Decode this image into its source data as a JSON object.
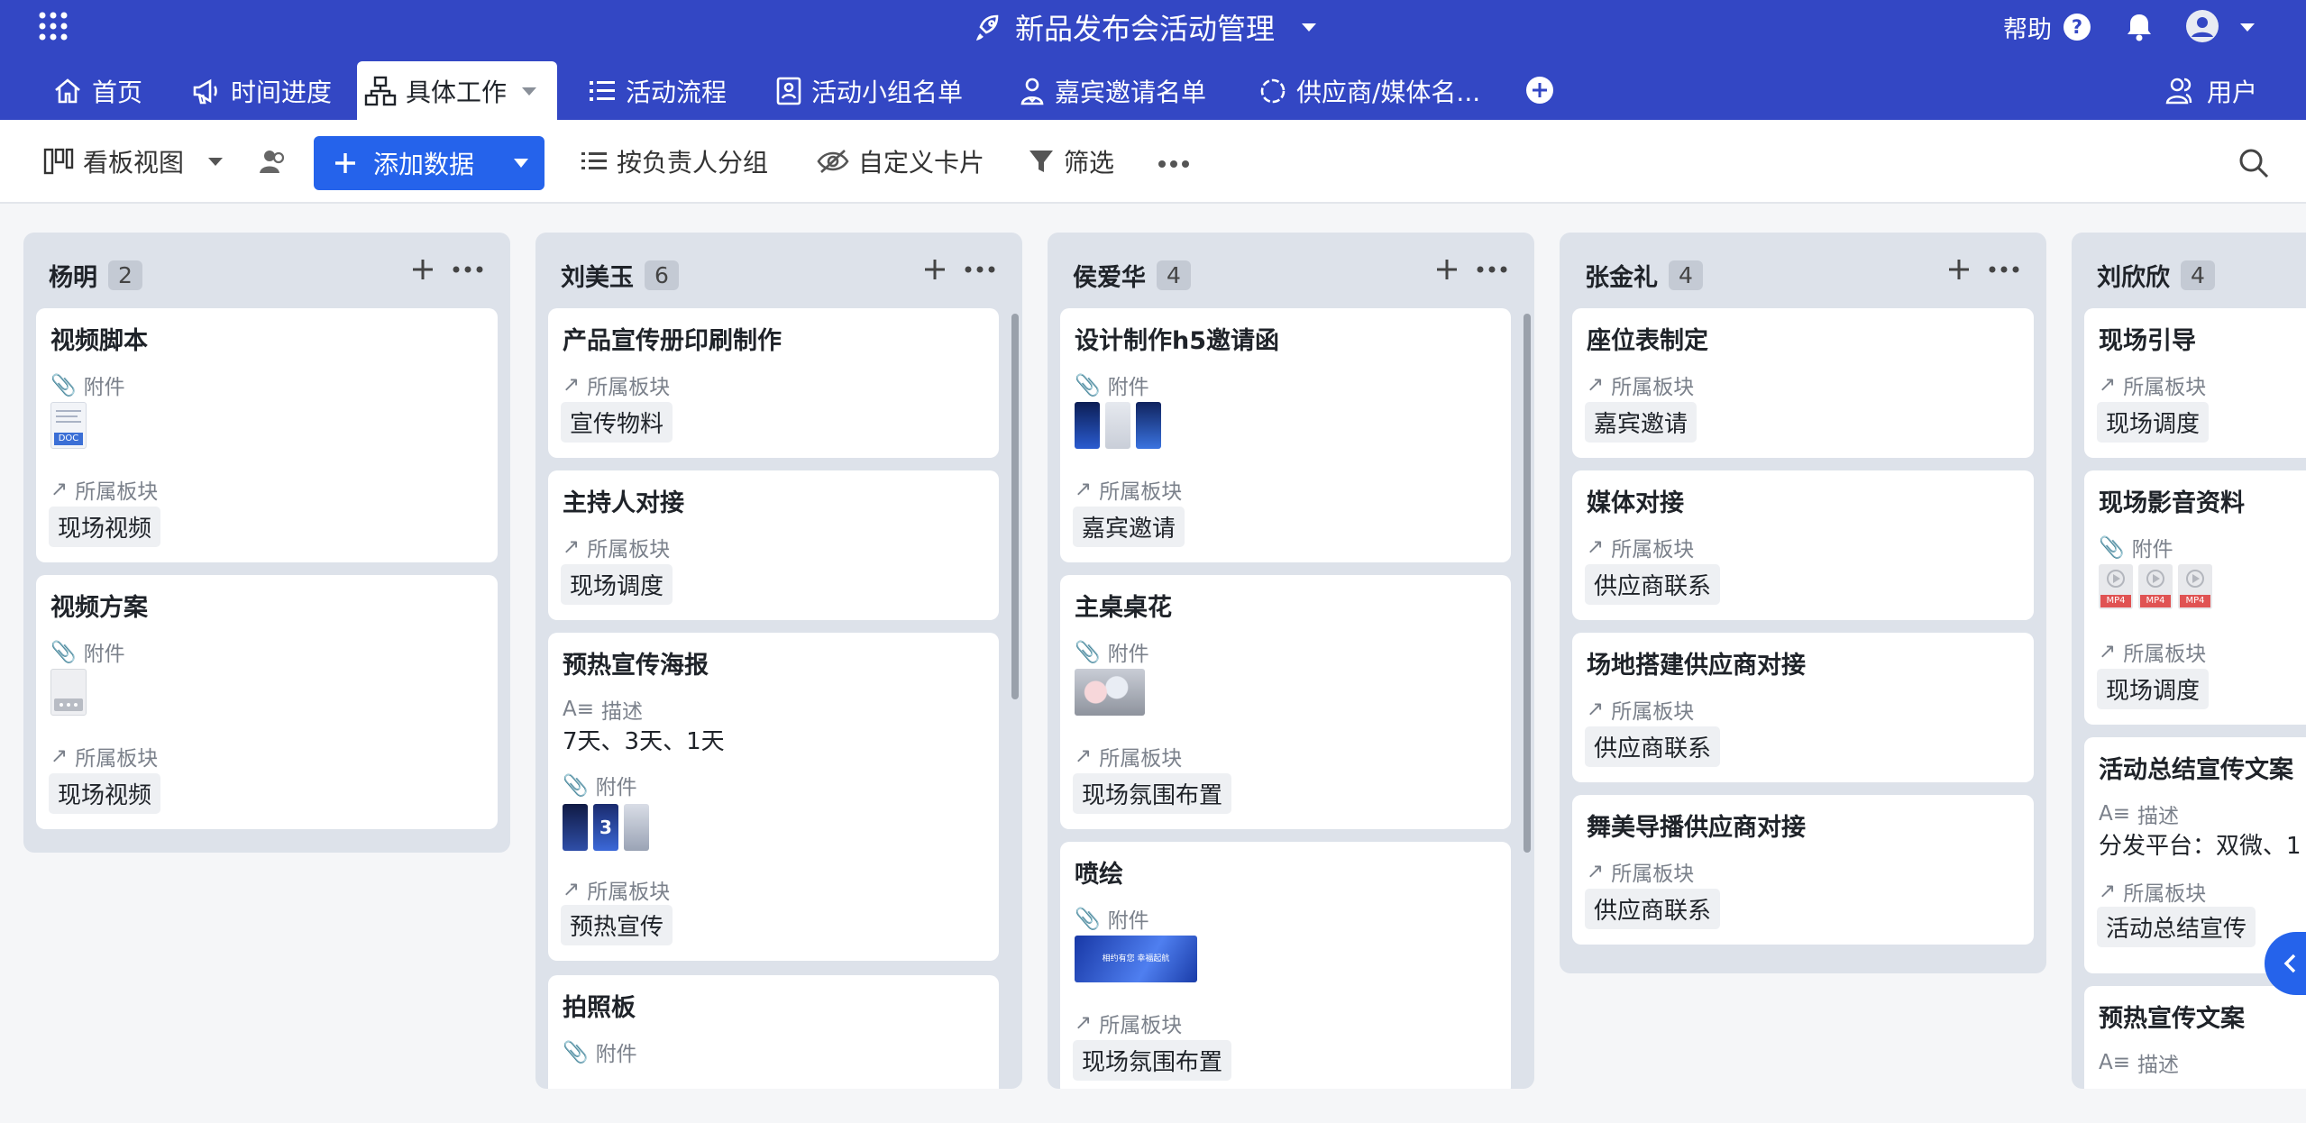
{
  "app": {
    "title": "新品发布会活动管理",
    "help": "帮助"
  },
  "tabs": [
    {
      "label": "首页",
      "icon": "home-icon"
    },
    {
      "label": "时间进度",
      "icon": "megaphone-icon"
    },
    {
      "label": "具体工作",
      "icon": "hierarchy-icon",
      "active": true
    },
    {
      "label": "活动流程",
      "icon": "list-icon"
    },
    {
      "label": "活动小组名单",
      "icon": "badge-icon"
    },
    {
      "label": "嘉宾邀请名单",
      "icon": "person-icon"
    },
    {
      "label": "供应商/媒体名...",
      "icon": "circle-dashed-icon"
    }
  ],
  "users_label": "用户",
  "toolbar": {
    "view": "看板视图",
    "add": "添加数据",
    "group": "按负责人分组",
    "custom": "自定义卡片",
    "filter": "筛选"
  },
  "labels": {
    "attach": "附件",
    "section": "所属板块",
    "desc": "描述"
  },
  "columns": [
    {
      "name": "杨明",
      "count": "2"
    },
    {
      "name": "刘美玉",
      "count": "6"
    },
    {
      "name": "侯爱华",
      "count": "4"
    },
    {
      "name": "张金礼",
      "count": "4"
    },
    {
      "name": "刘欣欣",
      "count": "4"
    }
  ],
  "cards": {
    "c0": [
      {
        "title": "视频脚本",
        "tag": "现场视频",
        "file": "DOC"
      },
      {
        "title": "视频方案",
        "tag": "现场视频"
      }
    ],
    "c1": [
      {
        "title": "产品宣传册印刷制作",
        "tag": "宣传物料"
      },
      {
        "title": "主持人对接",
        "tag": "现场调度"
      },
      {
        "title": "预热宣传海报",
        "desc": "7天、3天、1天",
        "tag": "预热宣传",
        "poster3": "3"
      },
      {
        "title": "拍照板"
      }
    ],
    "c2": [
      {
        "title": "设计制作h5邀请函",
        "tag": "嘉宾邀请"
      },
      {
        "title": "主桌桌花",
        "tag": "现场氛围布置"
      },
      {
        "title": "喷绘",
        "tag": "现场氛围布置",
        "banner": "相约有您  幸福起航"
      }
    ],
    "c3": [
      {
        "title": "座位表制定",
        "tag": "嘉宾邀请"
      },
      {
        "title": "媒体对接",
        "tag": "供应商联系"
      },
      {
        "title": "场地搭建供应商对接",
        "tag": "供应商联系"
      },
      {
        "title": "舞美导播供应商对接",
        "tag": "供应商联系"
      }
    ],
    "c4": [
      {
        "title": "现场引导",
        "tag": "现场调度"
      },
      {
        "title": "现场影音资料",
        "tag": "现场调度",
        "file": "MP4"
      },
      {
        "title": "活动总结宣传文案",
        "desc": "分发平台：双微、1",
        "tag": "活动总结宣传"
      },
      {
        "title": "预热宣传文案"
      }
    ]
  },
  "colors": {
    "brand": "#3347c4",
    "primary": "#2563eb",
    "column": "#dde2ea"
  }
}
